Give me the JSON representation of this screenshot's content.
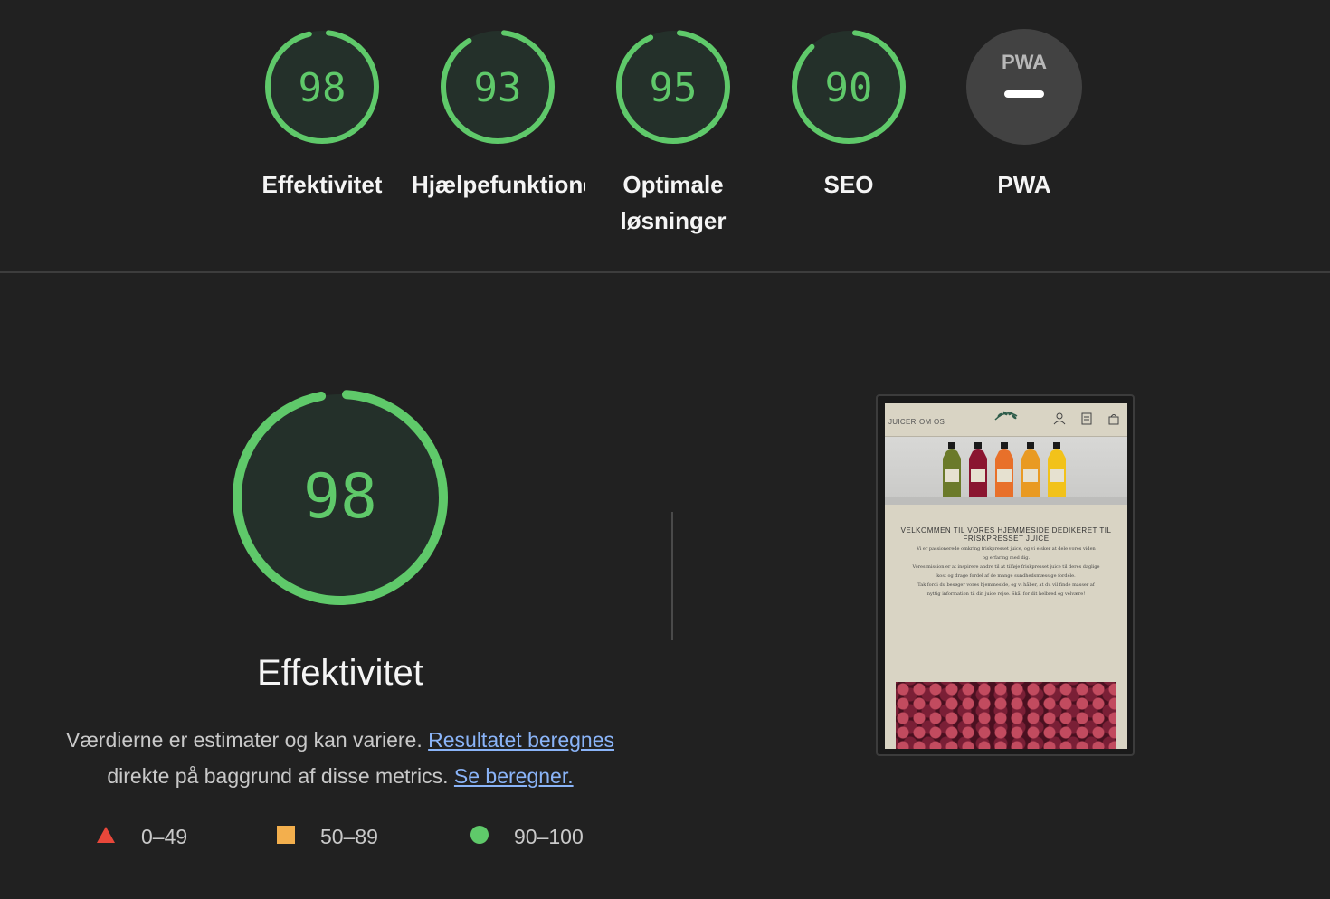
{
  "categories": [
    {
      "label": "Effektivitet",
      "score": 98
    },
    {
      "label": "Hjælpefunktioner",
      "score": 93
    },
    {
      "label": "Optimale løsninger",
      "score": 95
    },
    {
      "label": "SEO",
      "score": 90
    },
    {
      "label": "PWA",
      "score": null,
      "badge_text": "PWA"
    }
  ],
  "focused": {
    "title": "Effektivitet",
    "score": 98,
    "description_prefix": "Værdierne er estimater og kan variere.",
    "link1": "Resultatet beregnes",
    "description_middle": "direkte på baggrund af disse metrics.",
    "link2": "Se beregner."
  },
  "legend": [
    {
      "range": "0–49",
      "icon": "triangle-icon",
      "color": "#e8473a"
    },
    {
      "range": "50–89",
      "icon": "square-icon",
      "color": "#f3af4d"
    },
    {
      "range": "90–100",
      "icon": "circle-icon",
      "color": "#5fc96a"
    }
  ],
  "colors": {
    "pass": "#5fc96a",
    "pass_bg": "#24302a",
    "pwa_bg": "#424242",
    "background": "#212121",
    "link": "#8ab4f8"
  },
  "screenshot": {
    "nav_links": [
      "JUICER",
      "OM OS"
    ],
    "heading": "VELKOMMEN TIL VORES HJEMMESIDE DEDIKERET TIL FRISKPRESSET JUICE",
    "body_lines": [
      "Vi er passionerede omkring friskpresset juice, og vi elsker at dele vores viden",
      "og erfaring med dig.",
      "Vores mission er at inspirere andre til at tilføje friskpresset juice til deres daglige",
      "kost og drage fordel af de mange sundhedsmæssige fordele.",
      "Tak fordi du besøger vores hjemmeside, og vi håber, at du vil finde masser af",
      "nyttig information til din juice rejse. Skål for dit helbred og velvære!"
    ]
  }
}
